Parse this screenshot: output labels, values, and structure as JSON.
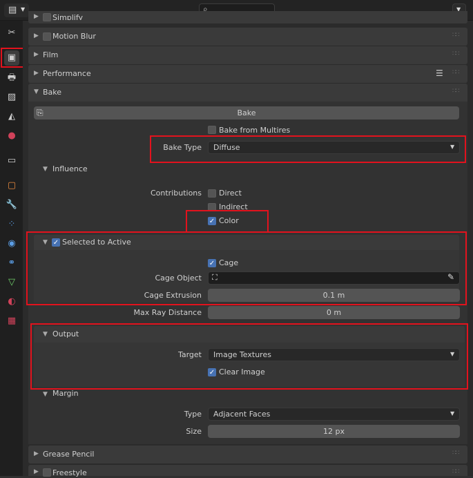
{
  "topbar": {
    "editor_icon": "properties-editor-icon",
    "search_icon": "search-icon",
    "dropdown_icon": "chevron-down-icon"
  },
  "sidebar": {
    "tabs": [
      {
        "icon": "tool-icon",
        "color": "#cfcfcf"
      },
      {
        "icon": "render-icon",
        "color": "#cfcfcf"
      },
      {
        "icon": "output-icon",
        "color": "#cfcfcf"
      },
      {
        "icon": "view-layer-icon",
        "color": "#cfcfcf"
      },
      {
        "icon": "scene-icon",
        "color": "#cfcfcf"
      },
      {
        "icon": "world-icon",
        "color": "#d0425a"
      },
      {
        "icon": "collection-icon",
        "color": "#cfcfcf"
      },
      {
        "icon": "object-icon",
        "color": "#e88a3e"
      },
      {
        "icon": "modifier-icon",
        "color": "#5b9ee6"
      },
      {
        "icon": "particles-icon",
        "color": "#5b9ee6"
      },
      {
        "icon": "physics-icon",
        "color": "#5b9ee6"
      },
      {
        "icon": "constraints-icon",
        "color": "#5b9ee6"
      },
      {
        "icon": "data-icon",
        "color": "#6fcf6a"
      },
      {
        "icon": "material-icon",
        "color": "#d0425a"
      },
      {
        "icon": "texture-icon",
        "color": "#d0425a"
      }
    ]
  },
  "panels": {
    "simplify": "Simplify",
    "motion_blur": "Motion Blur",
    "film": "Film",
    "performance": "Performance",
    "bake": "Bake",
    "grease_pencil": "Grease Pencil",
    "freestyle": "Freestyle"
  },
  "bake": {
    "bake_button": "Bake",
    "bake_from_multires": "Bake from Multires",
    "bake_type_label": "Bake Type",
    "bake_type_value": "Diffuse",
    "influence": {
      "title": "Influence",
      "contributions_label": "Contributions",
      "direct": "Direct",
      "indirect": "Indirect",
      "color": "Color"
    },
    "selected_to_active": {
      "title": "Selected to Active",
      "cage": "Cage",
      "cage_object_label": "Cage Object",
      "cage_extrusion_label": "Cage Extrusion",
      "cage_extrusion_value": "0.1 m",
      "max_ray_distance_label": "Max Ray Distance",
      "max_ray_distance_value": "0 m"
    },
    "output": {
      "title": "Output",
      "target_label": "Target",
      "target_value": "Image Textures",
      "clear_image": "Clear Image"
    },
    "margin": {
      "title": "Margin",
      "type_label": "Type",
      "type_value": "Adjacent Faces",
      "size_label": "Size",
      "size_value": "12 px"
    }
  },
  "states": {
    "motion_blur_checked": false,
    "bake_from_multires_checked": false,
    "direct_checked": false,
    "indirect_checked": false,
    "color_checked": true,
    "selected_to_active_checked": true,
    "cage_checked": true,
    "clear_image_checked": true,
    "freestyle_checked": false
  },
  "colors": {
    "highlight": "#e3121d",
    "accent": "#4772b3"
  }
}
